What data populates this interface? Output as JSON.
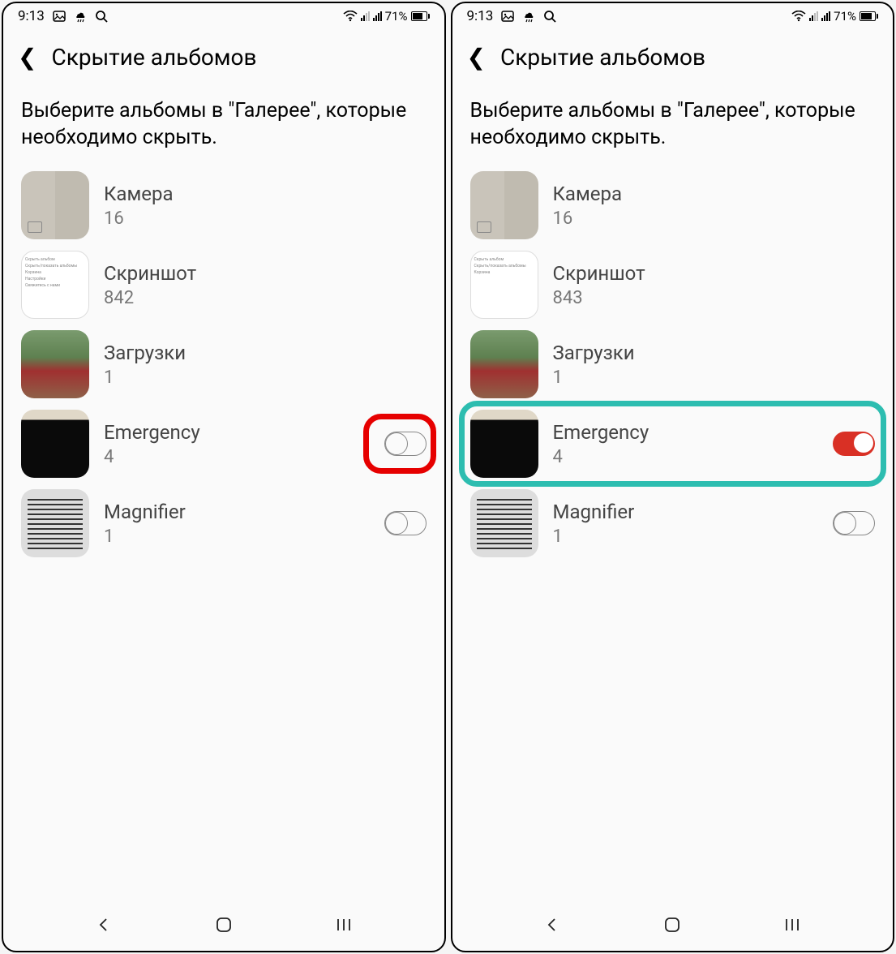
{
  "status": {
    "time": "9:13",
    "battery_pct": "71%"
  },
  "header": {
    "title": "Скрытие альбомов"
  },
  "subtitle": "Выберите альбомы в \"Галерее\", которые необходимо скрыть.",
  "screens": [
    {
      "albums": [
        {
          "name": "Камера",
          "count": "16",
          "toggle": null,
          "thumb": "camera"
        },
        {
          "name": "Скриншот",
          "count": "842",
          "toggle": null,
          "thumb": "screenshot"
        },
        {
          "name": "Загрузки",
          "count": "1",
          "toggle": null,
          "thumb": "downloads"
        },
        {
          "name": "Emergency",
          "count": "4",
          "toggle": "off",
          "thumb": "emergency",
          "highlight": "red"
        },
        {
          "name": "Magnifier",
          "count": "1",
          "toggle": "off",
          "thumb": "magnifier"
        }
      ]
    },
    {
      "albums": [
        {
          "name": "Камера",
          "count": "16",
          "toggle": null,
          "thumb": "camera"
        },
        {
          "name": "Скриншот",
          "count": "843",
          "toggle": null,
          "thumb": "screenshot"
        },
        {
          "name": "Загрузки",
          "count": "1",
          "toggle": null,
          "thumb": "downloads"
        },
        {
          "name": "Emergency",
          "count": "4",
          "toggle": "on",
          "thumb": "emergency",
          "highlight": "teal"
        },
        {
          "name": "Magnifier",
          "count": "1",
          "toggle": "off",
          "thumb": "magnifier"
        }
      ]
    }
  ],
  "screenshot_thumb_lines": [
    "Скрыть альбом",
    "Скрыть/показать альбомы",
    "Корзина",
    "Настройки",
    "Свяжитесь с нами"
  ]
}
